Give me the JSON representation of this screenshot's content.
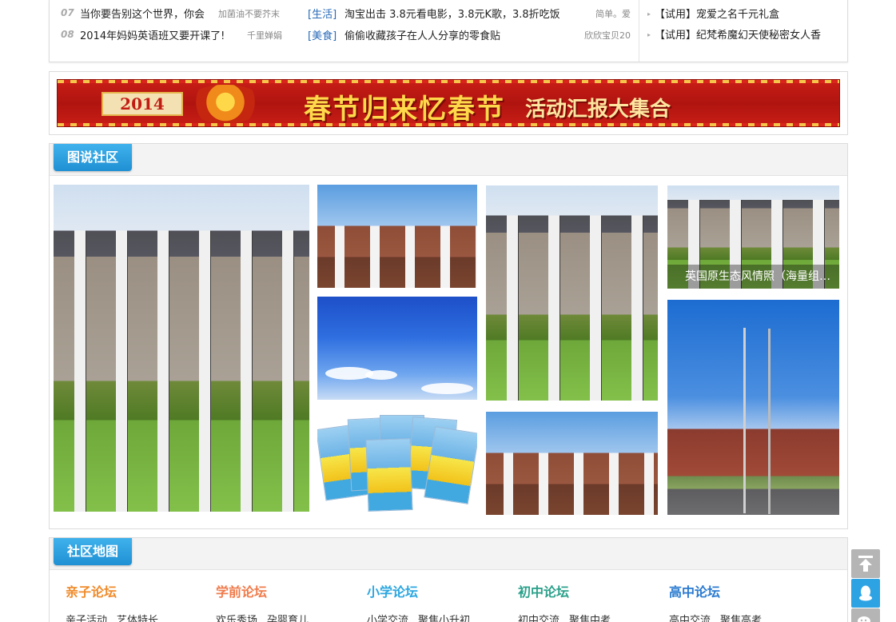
{
  "news": [
    {
      "num": "07",
      "title": "当你要告别这个世界，你会",
      "author": "加菌油不要芥末",
      "category": "[生活]",
      "title2": "淘宝出击 3.8元看电影，3.8元K歌，3.8折吃饭",
      "author2": "简单。爱"
    },
    {
      "num": "08",
      "title": "2014年妈妈英语班又要开课了!",
      "author": "千里婵娟",
      "category": "[美食]",
      "title2": "偷偷收藏孩子在人人分享的零食贴",
      "author2": "欣欣宝贝20"
    }
  ],
  "trials": [
    {
      "text": "【试用】宠爱之名千元礼盒"
    },
    {
      "text": "【试用】纪梵希魔幻天使秘密女人香"
    }
  ],
  "banner": {
    "year": "2014",
    "headline": "春节归来忆春节",
    "subline": "活动汇报大集合",
    "colors": {
      "bg": "#c91e17",
      "text": "#ffd94a"
    }
  },
  "photo_section": {
    "title": "图说社区",
    "caption": "英国原生态风情照（海量组图）"
  },
  "map_section": {
    "title": "社区地图",
    "forums": [
      {
        "title": "亲子论坛",
        "color": "#f08a2a",
        "links": [
          "亲子活动",
          "艺体特长"
        ]
      },
      {
        "title": "学前论坛",
        "color": "#f07a4a",
        "links": [
          "欢乐秀场",
          "孕婴育儿"
        ]
      },
      {
        "title": "小学论坛",
        "color": "#2aa6e0",
        "links": [
          "小学交流",
          "聚焦小升初"
        ]
      },
      {
        "title": "初中论坛",
        "color": "#2aa08a",
        "links": [
          "初中交流",
          "聚焦中考"
        ]
      },
      {
        "title": "高中论坛",
        "color": "#2a7ad0",
        "links": [
          "高中交流",
          "聚焦高考"
        ]
      }
    ]
  },
  "side_buttons": [
    {
      "icon": "back-to-top-icon"
    },
    {
      "icon": "qq-icon"
    },
    {
      "icon": "wechat-icon"
    }
  ]
}
